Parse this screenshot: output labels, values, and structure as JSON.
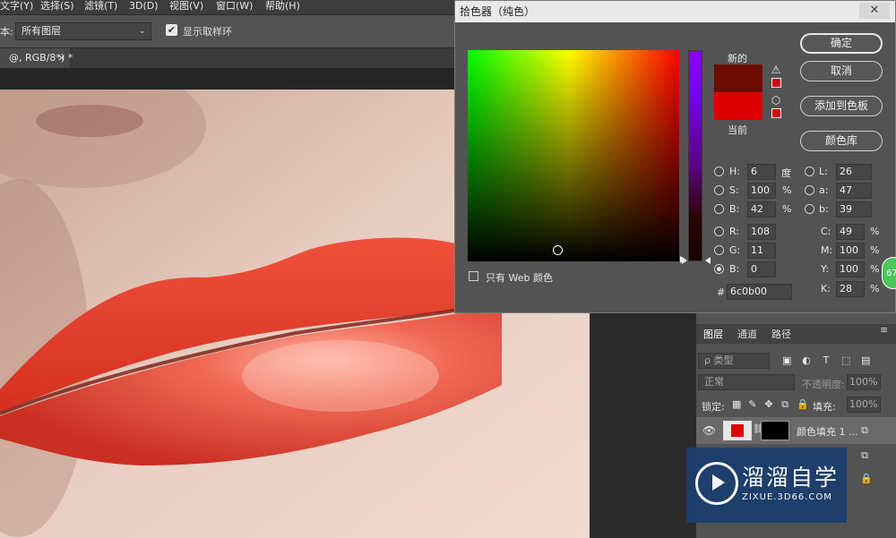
{
  "menu": [
    "文字(Y)",
    "选择(S)",
    "滤镜(T)",
    "3D(D)",
    "视图(V)",
    "窗口(W)",
    "帮助(H)"
  ],
  "options_bar": {
    "sample_label": "本:",
    "layer_select_value": "所有图层",
    "show_ring_label": "显示取样环",
    "show_ring_checked": true
  },
  "doc_tab": {
    "title": "@, RGB/8*) *",
    "close": "×"
  },
  "color_picker": {
    "title": "拾色器（纯色）",
    "close": "✕",
    "new_label": "新的",
    "current_label": "当前",
    "new_color": "#6c0b00",
    "current_color": "#dd0000",
    "buttons": {
      "ok": "确定",
      "cancel": "取消",
      "add_to_swatches": "添加到色板",
      "color_libraries": "颜色库"
    },
    "web_only_label": "只有 Web 颜色",
    "fields": {
      "H": "6",
      "S": "100",
      "B_hsb": "42",
      "R": "108",
      "G": "11",
      "B_rgb": "0",
      "L": "26",
      "a": "47",
      "b": "39",
      "C": "49",
      "M": "100",
      "Y": "100",
      "K": "28"
    },
    "labels": {
      "H": "H:",
      "S": "S:",
      "B_hsb": "B:",
      "R": "R:",
      "G": "G:",
      "B_rgb": "B:",
      "L": "L:",
      "a": "a:",
      "b": "b:",
      "C": "C:",
      "M": "M:",
      "Y": "Y:",
      "K": "K:",
      "hash": "#"
    },
    "units": {
      "degree": "度",
      "percent": "%"
    },
    "hex": "6c0b00",
    "selected_mode": "B_rgb"
  },
  "badge_text": "67",
  "layers_panel": {
    "tabs": [
      "图层",
      "通道",
      "路径"
    ],
    "kind_placeholder": "ρ 类型",
    "blend_mode": "正常",
    "opacity_label": "不透明度:",
    "opacity_value": "100%",
    "lock_label": "锁定:",
    "fill_label": "填充:",
    "fill_value": "100%",
    "layer_name": "颜色填充 1 ..."
  },
  "watermark": {
    "title": "溜溜自学",
    "subtitle": "ZIXUE.3D66.COM"
  },
  "colors": {
    "accent_red": "#dd0000",
    "new_red": "#6c0b00",
    "ui_gray": "#535353",
    "badge_green": "#4ac65a"
  }
}
